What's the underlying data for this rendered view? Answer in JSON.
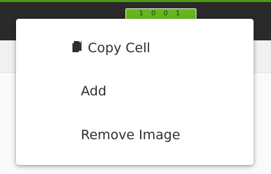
{
  "header": {
    "badge_text": "1 0 0 1"
  },
  "menu": {
    "items": [
      {
        "label": "Copy Cell",
        "icon": "copy-icon"
      },
      {
        "label": "Add"
      },
      {
        "label": "Remove Image"
      }
    ]
  },
  "colors": {
    "header_bg": "#2a2a2a",
    "accent_green": "#64b81e",
    "menu_bg": "#ffffff",
    "menu_text": "#2f2f2f"
  }
}
